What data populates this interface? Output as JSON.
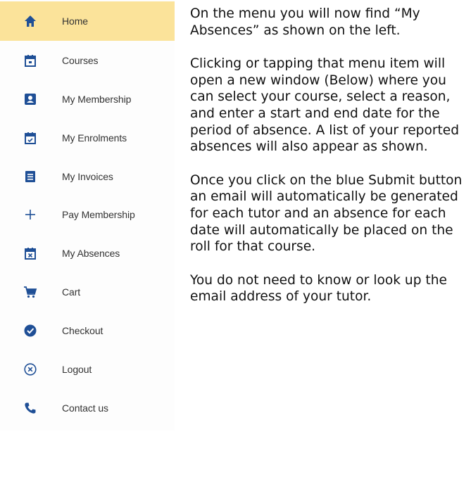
{
  "colors": {
    "active_highlight": "#fbe39a",
    "icon_blue": "#1f4f96",
    "label_text": "#333333",
    "body_text": "#111111"
  },
  "menu": {
    "items": [
      {
        "label": "Home",
        "icon": "home-icon",
        "active": true
      },
      {
        "label": "Courses",
        "icon": "calendar-icon"
      },
      {
        "label": "My Membership",
        "icon": "id-card-icon"
      },
      {
        "label": "My Enrolments",
        "icon": "calendar-check-icon"
      },
      {
        "label": "My Invoices",
        "icon": "list-icon"
      },
      {
        "label": "Pay Membership",
        "icon": "plus-icon"
      },
      {
        "label": "My Absences",
        "icon": "calendar-x-icon"
      },
      {
        "label": "Cart",
        "icon": "cart-icon"
      },
      {
        "label": "Checkout",
        "icon": "check-circle-icon"
      },
      {
        "label": "Logout",
        "icon": "close-circle-icon"
      },
      {
        "label": "Contact us",
        "icon": "phone-icon"
      }
    ]
  },
  "instructions": {
    "paragraphs": [
      "On the menu you will now find “My Absences” as shown on the left.",
      "Clicking or tapping that menu item will open a new window (Below) where you can select your course, select a reason, and enter a start and end date for the period of absence. A list of your reported absences will also appear as shown.",
      "Once you click on the blue Submit button an email will automatically be generated for each tutor and an absence for each date will automatically be placed on the roll for that course.",
      "You do not need to know or look up the email address of your tutor."
    ]
  }
}
